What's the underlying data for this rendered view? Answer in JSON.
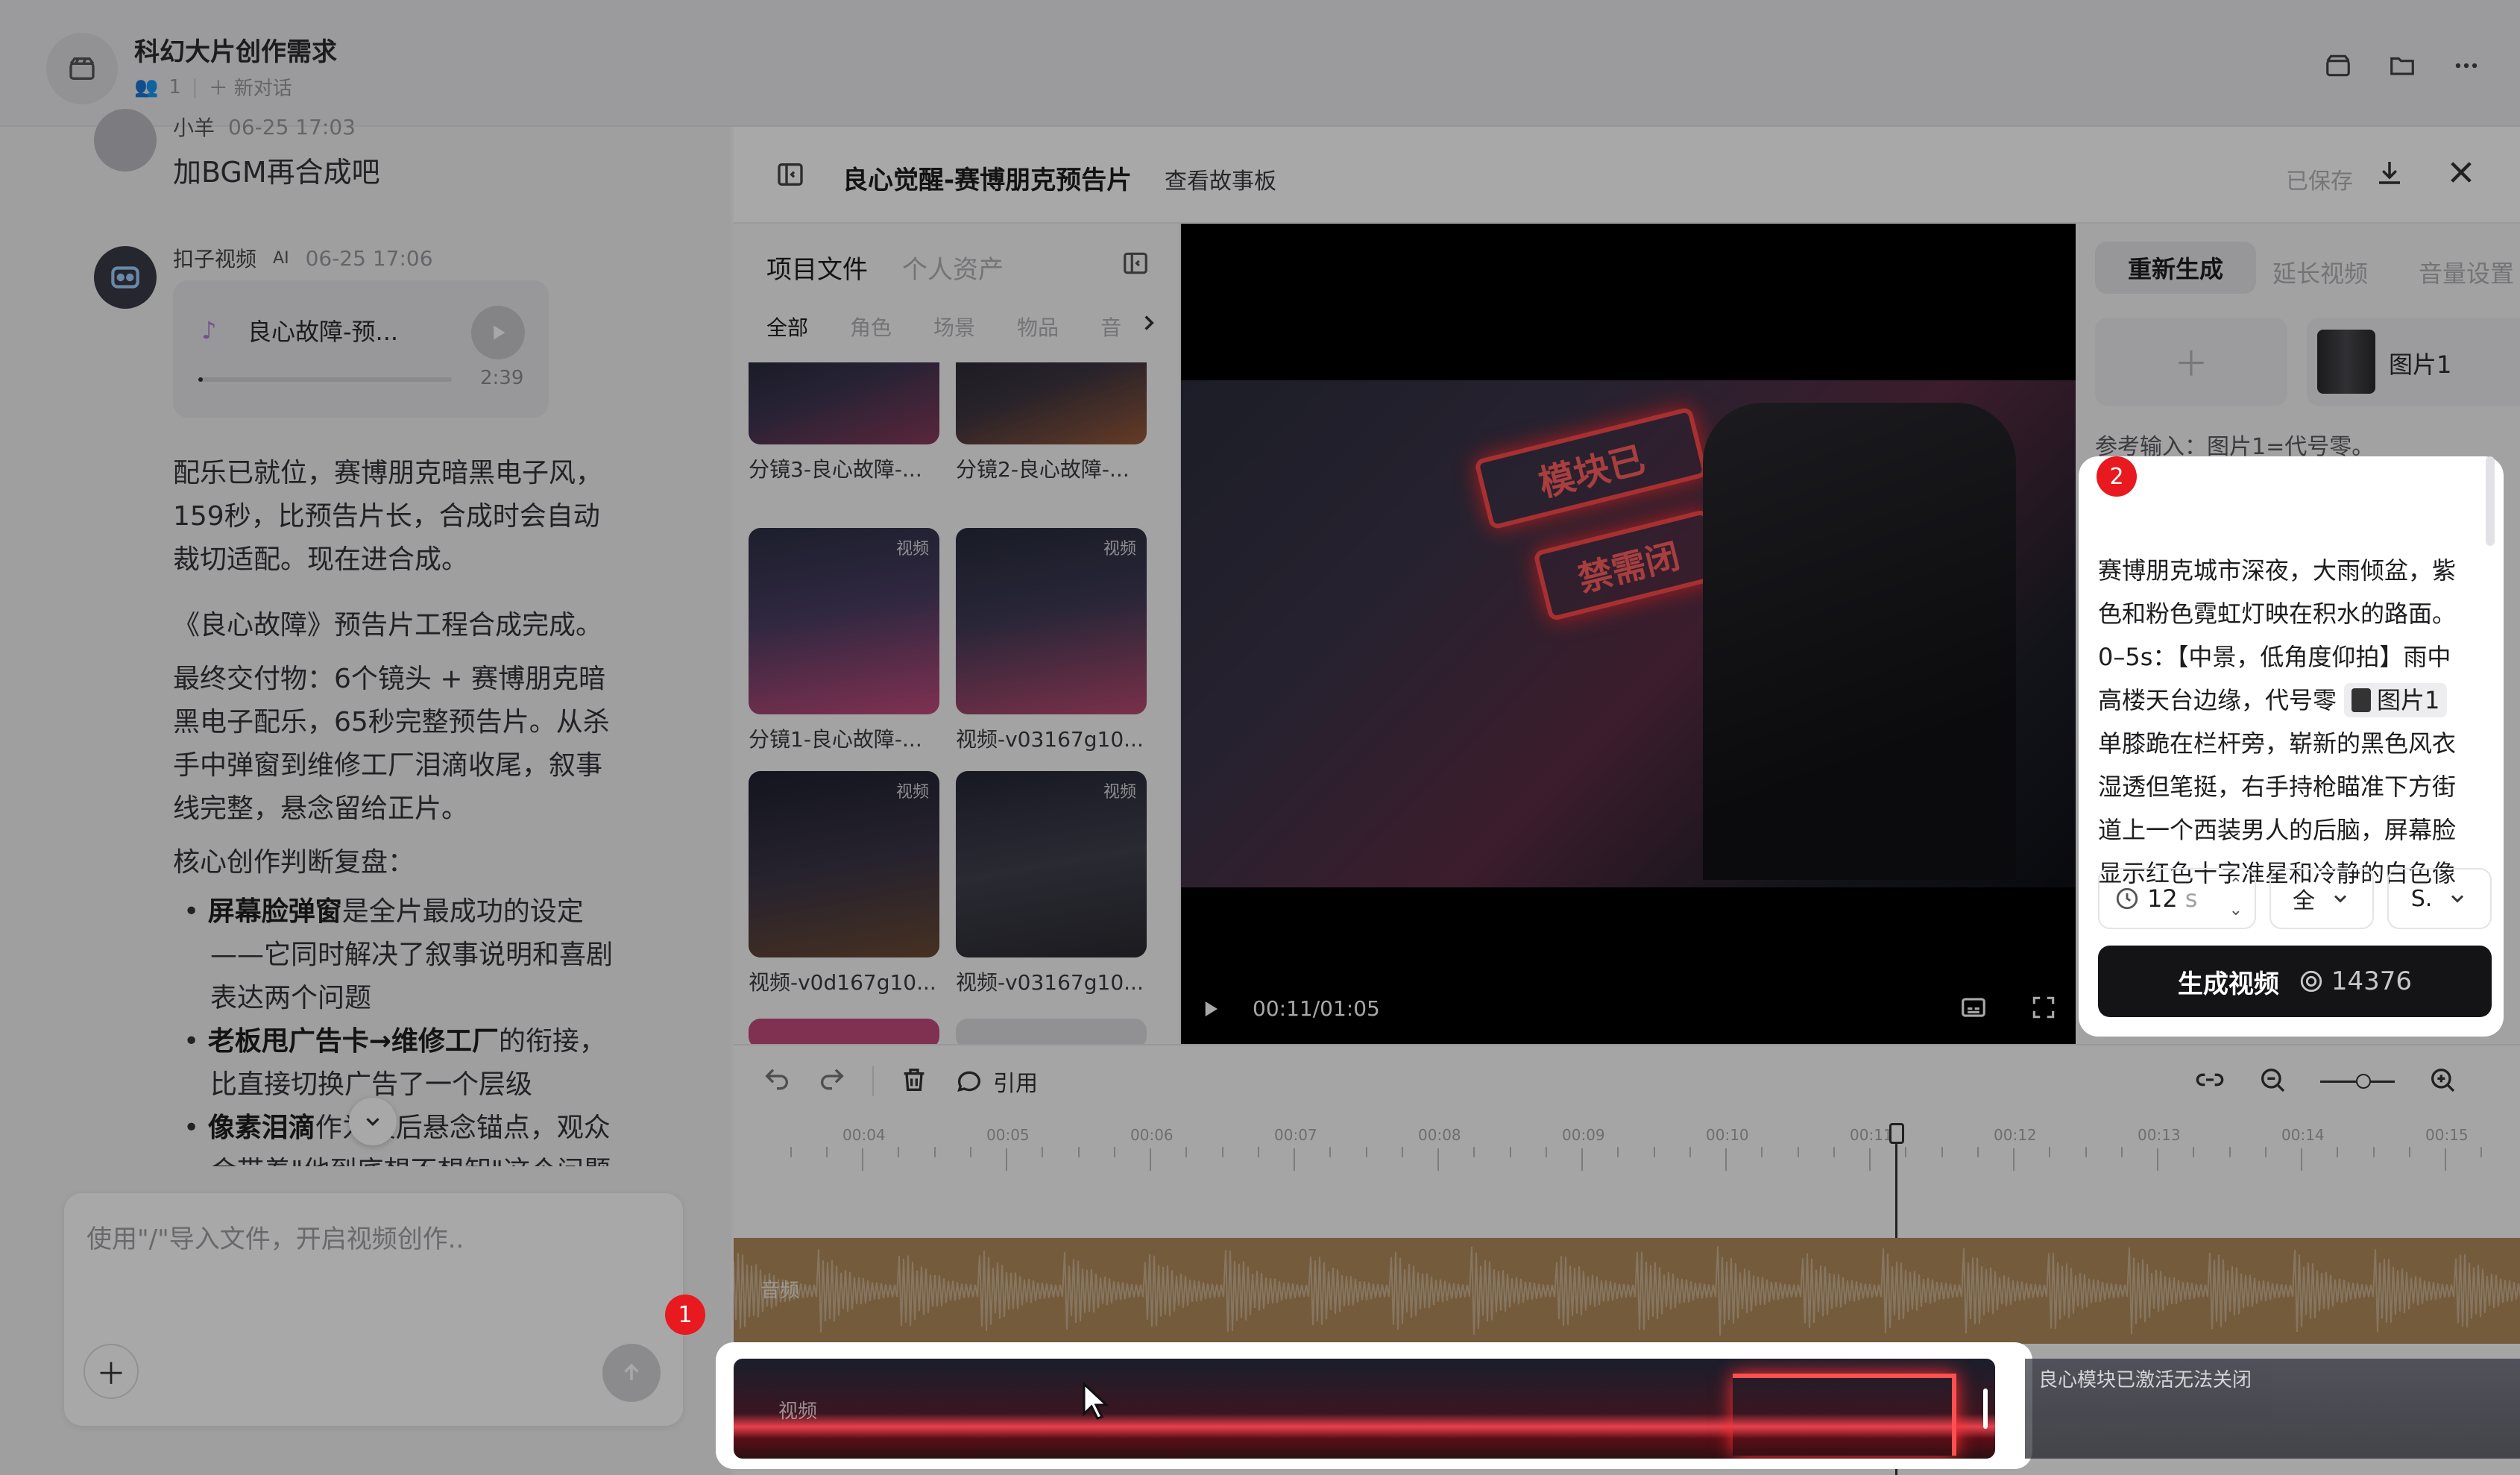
{
  "header": {
    "title": "科幻大片创作需求",
    "member_count": "1",
    "new_chat": "新对话"
  },
  "chat": {
    "prev_sender": "小羊",
    "prev_time": "06-25 17:03",
    "prev_message": "加BGM再合成吧",
    "bot_name": "扣子视频",
    "bot_badge": "AI",
    "bot_time": "06-25 17:06",
    "audio_card": {
      "title": "良心故障-预...",
      "duration": "2:39"
    },
    "p1": [
      "配乐已就位，赛博朋克暗黑电子风，",
      "159秒，比预告片长，合成时会自动",
      "裁切适配。现在进合成。"
    ],
    "p2": "《良心故障》预告片工程合成完成。",
    "p3": [
      "最终交付物：6个镜头 + 赛博朋克暗",
      "黑电子配乐，65秒完整预告片。从杀",
      "手中弹窗到维修工厂泪滴收尾，叙事",
      "线完整，悬念留给正片。"
    ],
    "p4": "核心创作判断复盘：",
    "bullets": [
      {
        "bold": "屏幕脸弹窗",
        "rest": "是全片最成功的设定",
        "cont": [
          "——它同时解决了叙事说明和喜剧",
          "表达两个问题"
        ]
      },
      {
        "bold": "老板甩广告卡→维修工厂",
        "rest": "的衔接，",
        "cont": [
          "比直接切换广告了一个层级"
        ]
      },
      {
        "bold": "像素泪滴",
        "rest": "作为最后悬念锚点，观众",
        "cont": [
          "会带着\"他到底想不想卸\"这个问题"
        ]
      }
    ],
    "input_placeholder": "使用\"/\"导入文件，开启视频创作.."
  },
  "editor": {
    "title": "良心觉醒-赛博朋克预告片",
    "storyboard_link": "查看故事板",
    "saved": "已保存",
    "asset_tabs": [
      "项目文件",
      "个人资产"
    ],
    "filters": [
      "全部",
      "角色",
      "场景",
      "物品",
      "音"
    ],
    "thumbnails": [
      {
        "label": "分镜3-良心故障-...",
        "badge": ""
      },
      {
        "label": "分镜2-良心故障-...",
        "badge": ""
      },
      {
        "label": "分镜1-良心故障-...",
        "badge": "视频"
      },
      {
        "label": "视频-v03167g10...",
        "badge": "视频"
      },
      {
        "label": "视频-v0d167g10...",
        "badge": "视频"
      },
      {
        "label": "视频-v03167g10...",
        "badge": "视频"
      }
    ],
    "player": {
      "time": "00:11/01:05",
      "sign1": "模块已",
      "sign2": "禁需闭"
    },
    "right_tabs": [
      "重新生成",
      "延长视频",
      "音量设置"
    ],
    "ref_image_label": "图片1",
    "ref_input": "参考输入：图片1=代号零。",
    "prompt_lines": [
      "赛博朋克城市深夜，大雨倾盆，紫",
      "色和粉色霓虹灯映在积水的路面。",
      "0–5s：【中景，低角度仰拍】雨中",
      "高楼天台边缘，代号零",
      "单膝跪在栏杆旁，崭新的黑色风衣",
      "湿透但笔挺，右手持枪瞄准下方街",
      "道上一个西装男人的后脑，屏幕脸",
      "显示红色十字准星和冷静的白色像"
    ],
    "prompt_inline_tag": "图片1",
    "duration_value": "12",
    "duration_unit": "s",
    "select1": "全",
    "select2": "S.",
    "generate_label": "生成视频",
    "generate_cost": "14376",
    "timeline": {
      "cite_label": "引用",
      "ruler": [
        "00:04",
        "00:05",
        "00:06",
        "00:07",
        "00:08",
        "00:09",
        "00:10",
        "00:11",
        "00:12",
        "00:13",
        "00:14",
        "00:15"
      ],
      "audio_track_label": "音频",
      "video_track_label": "视频",
      "next_clip_label": "良心模块已激活无法关闭"
    }
  },
  "markers": {
    "m1": "1",
    "m2": "2"
  }
}
